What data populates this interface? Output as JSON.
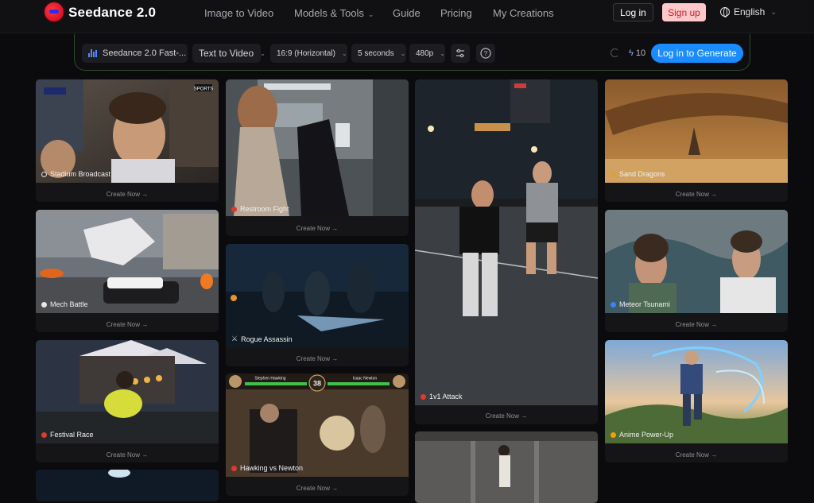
{
  "nav": {
    "brand": "Seedance 2.0",
    "links": [
      {
        "label": "Image to Video",
        "has_menu": false
      },
      {
        "label": "Models & Tools",
        "has_menu": true
      },
      {
        "label": "Guide",
        "has_menu": false
      },
      {
        "label": "Pricing",
        "has_menu": false
      },
      {
        "label": "My Creations",
        "has_menu": false
      }
    ],
    "login_label": "Log in",
    "signup_label": "Sign up",
    "language": "English"
  },
  "toolbar": {
    "model": "Seedance 2.0 Fast-...",
    "mode": "Text to Video",
    "aspect_ratio": "16:9 (Horizontal)",
    "duration": "5 seconds",
    "resolution": "480p",
    "credits": "10",
    "generate_label": "Log in to Generate"
  },
  "cta_label": "Create Now →",
  "cards": [
    {
      "title": "Stadium Broadcast",
      "icon": "dot"
    },
    {
      "title": "Mech Battle",
      "icon": "dot"
    },
    {
      "title": "Festival Race",
      "icon": "dot"
    },
    {
      "title": "Restroom Fight",
      "icon": "dot"
    },
    {
      "title": "Rogue Assassin",
      "icon": "dagger-icon"
    },
    {
      "title": "Hawking vs Newton",
      "icon": "dot"
    },
    {
      "title": "1v1 Attack",
      "icon": "dot"
    },
    {
      "title": "Sand Dragons",
      "icon": "dot"
    },
    {
      "title": "Meteor Tsunami",
      "icon": "dot"
    },
    {
      "title": "Anime Power-Up",
      "icon": "dot"
    }
  ],
  "overlays": {
    "stadium_brand": "SPORTS",
    "fight_hud": {
      "left_name": "Stephen Hawking",
      "right_name": "Isaac Newton",
      "timer": "38"
    }
  },
  "colors": {
    "accent": "#1a8cff",
    "signup_bg": "#ffc9c9",
    "signup_text": "#c51f2d"
  }
}
